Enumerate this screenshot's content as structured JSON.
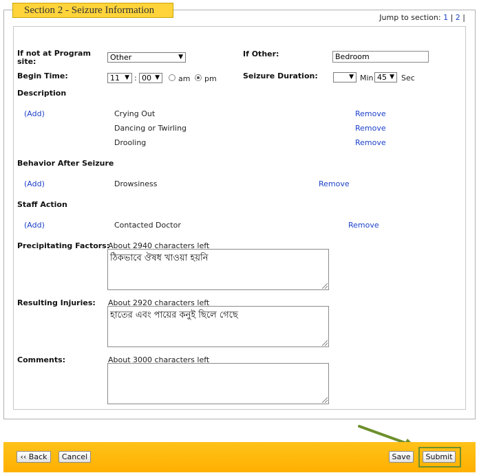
{
  "section": {
    "title": "Section 2 - Seizure Information"
  },
  "jump": {
    "label": "Jump to section:",
    "link1": "1",
    "sep1": "|",
    "link2": "2",
    "sep2": "|"
  },
  "location": {
    "label": "If not at Program site:",
    "value": "Other"
  },
  "other": {
    "label": "If Other:",
    "value": "Bedroom"
  },
  "begin_time": {
    "label": "Begin Time:",
    "hour": "11",
    "colon": ":",
    "minute": "00",
    "am": "am",
    "pm": "pm",
    "selected": "pm"
  },
  "duration": {
    "label": "Seizure Duration:",
    "minutes": "",
    "min_label": "Min",
    "seconds": "45",
    "sec_label": "Sec"
  },
  "description": {
    "label": "Description",
    "add": "(Add)",
    "remove": "Remove",
    "items": [
      "Crying Out",
      "Dancing or Twirling",
      "Drooling"
    ]
  },
  "behavior": {
    "label": "Behavior After Seizure",
    "add": "(Add)",
    "remove": "Remove",
    "items": [
      "Drowsiness"
    ]
  },
  "staff": {
    "label": "Staff Action",
    "add": "(Add)",
    "remove": "Remove",
    "items": [
      "Contacted Doctor"
    ]
  },
  "precipitating": {
    "label": "Precipitating Factors:",
    "counter": "About 2940 characters left",
    "value": "ঠিকভাবে ঔষধ খাওয়া হয়নি"
  },
  "injuries": {
    "label": "Resulting Injuries:",
    "counter": "About 2920 characters left",
    "value": "হাতের এবং পায়ের কনুই ছিলে গেছে"
  },
  "comments": {
    "label": "Comments:",
    "counter": "About 3000 characters left",
    "value": ""
  },
  "footer": {
    "back": "‹‹ Back",
    "cancel": "Cancel",
    "save": "Save",
    "submit": "Submit"
  },
  "colors": {
    "accent": "#ffc21a",
    "link": "#1b3fc9",
    "highlight": "#6d8f2c"
  }
}
